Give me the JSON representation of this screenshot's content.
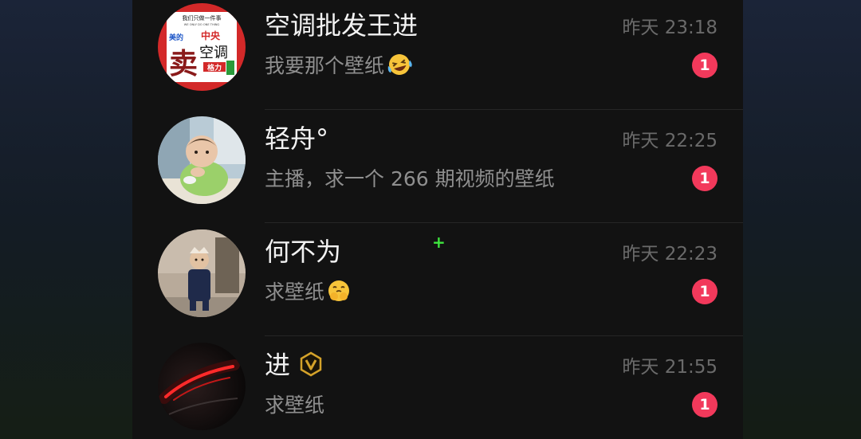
{
  "chats": [
    {
      "name": "空调批发王进",
      "preview": "我要那个壁纸",
      "preview_emoji": "laughing-crying-emoji",
      "time": "昨天 23:18",
      "unread": "1",
      "avatar_logo": {
        "top_text": "我们只做一件事",
        "sub_text": "WE ONLY DO ONE THING",
        "brand_left": "美的",
        "brand_center": "中央",
        "big_char": "卖",
        "main_text": "空调",
        "brand_bottom": "格力"
      }
    },
    {
      "name": "轻舟°",
      "preview": "主播，求一个 266 期视频的壁纸",
      "time": "昨天 22:25",
      "unread": "1"
    },
    {
      "name": "何不为",
      "preview": "求壁纸",
      "preview_emoji": "pleading-hands-emoji",
      "time": "昨天 22:23",
      "unread": "1"
    },
    {
      "name": "进",
      "verified_icon": "verified-v-icon",
      "preview": "求壁纸",
      "time": "昨天 21:55",
      "unread": "1"
    }
  ],
  "colors": {
    "badge": "#f2395b",
    "verified": "#d4a22a",
    "cursor_plus": "#3ee63e"
  }
}
